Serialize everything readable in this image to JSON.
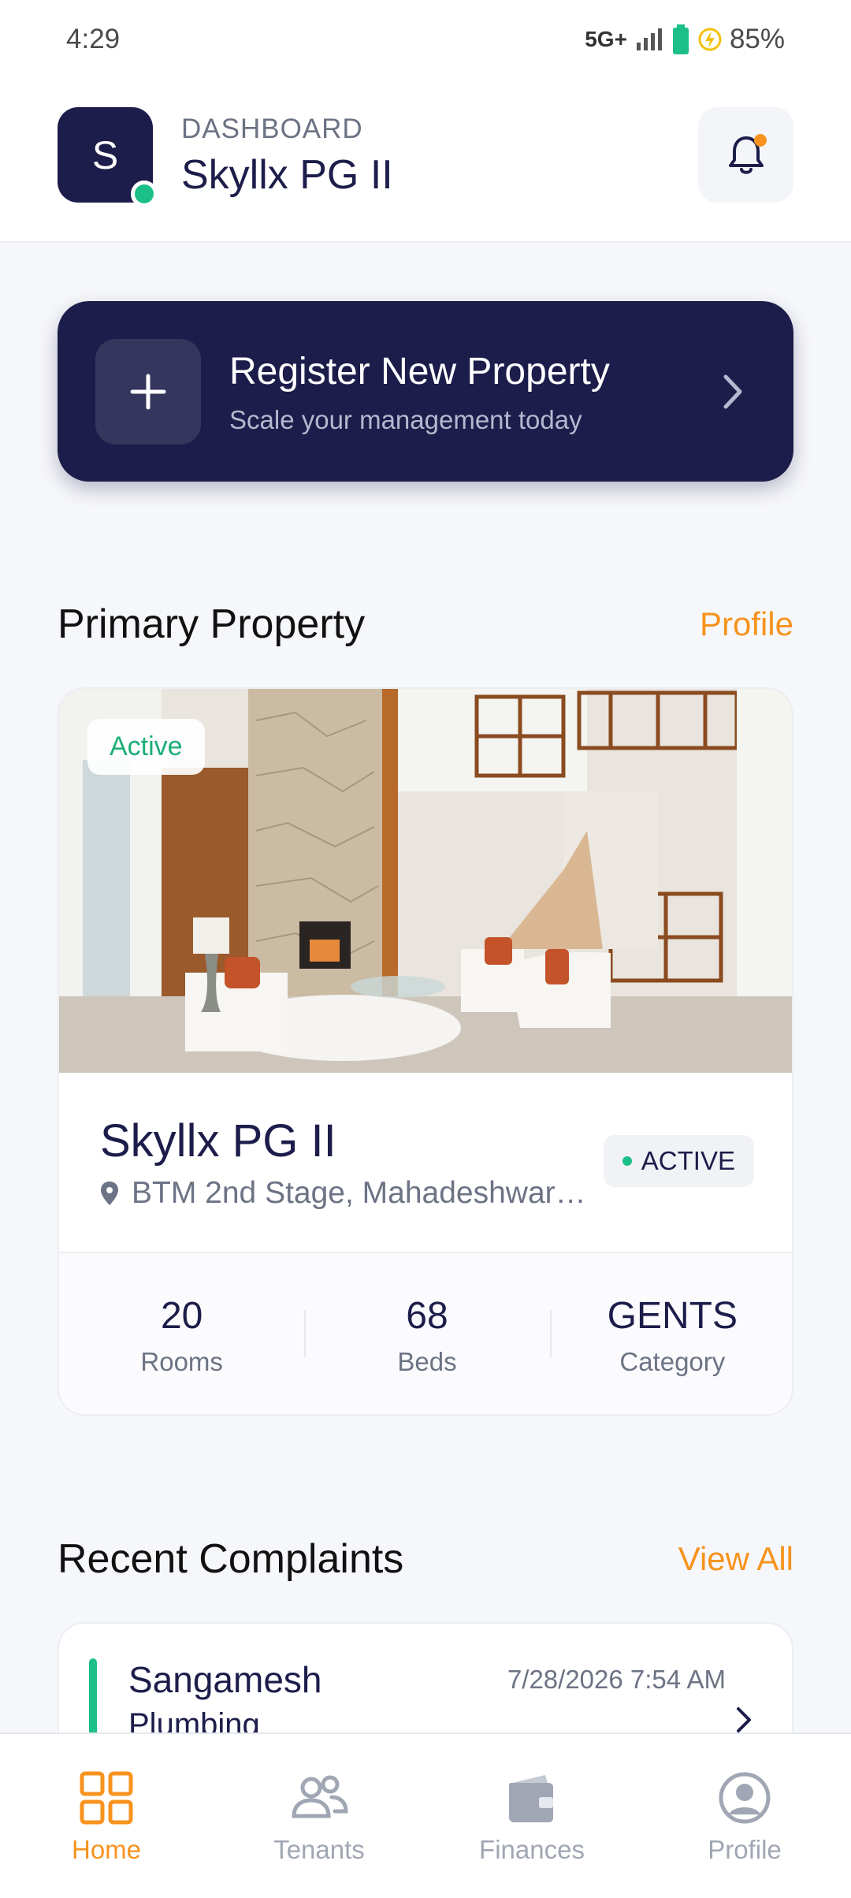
{
  "status_bar": {
    "time": "4:29",
    "network": "5G+",
    "battery": "85%"
  },
  "header": {
    "avatar_letter": "S",
    "kicker": "DASHBOARD",
    "title": "Skyllx PG II"
  },
  "register": {
    "title": "Register New Property",
    "subtitle": "Scale your management today"
  },
  "primary_section": {
    "title": "Primary Property",
    "link": "Profile"
  },
  "property": {
    "badge": "Active",
    "name": "Skyllx PG II",
    "location": "BTM 2nd Stage, Mahadeshwar…",
    "status": "ACTIVE",
    "stats": [
      {
        "value": "20",
        "label": "Rooms"
      },
      {
        "value": "68",
        "label": "Beds"
      },
      {
        "value": "GENTS",
        "label": "Category"
      }
    ]
  },
  "complaints_section": {
    "title": "Recent Complaints",
    "link": "View All"
  },
  "complaint": {
    "name": "Sangamesh",
    "category": "Plumbing",
    "timestamp": "7/28/2026 7:54 AM"
  },
  "nav": [
    {
      "label": "Home",
      "icon": "grid-icon",
      "active": true
    },
    {
      "label": "Tenants",
      "icon": "users-icon",
      "active": false
    },
    {
      "label": "Finances",
      "icon": "wallet-icon",
      "active": false
    },
    {
      "label": "Profile",
      "icon": "user-circle-icon",
      "active": false
    }
  ],
  "colors": {
    "primary": "#1c1d4a",
    "accent": "#f7931e",
    "success": "#1cbf87"
  }
}
